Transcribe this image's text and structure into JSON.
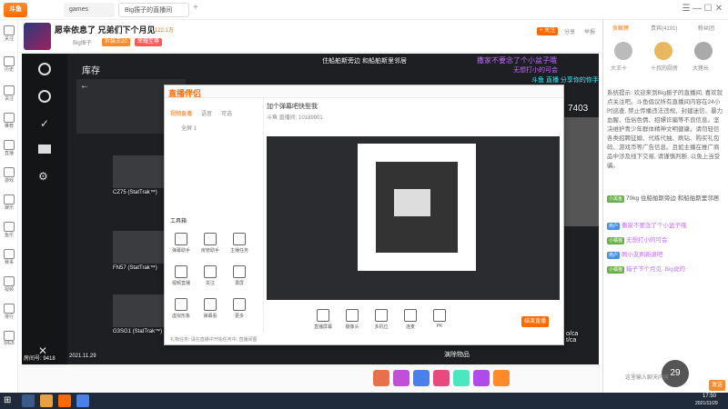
{
  "browser": {
    "logo": "斗鱼",
    "tab1_label": "games",
    "tab2_label": "Big振子的直播间",
    "window_controls": [
      "☰",
      "—",
      "☐",
      "✕"
    ]
  },
  "rail": {
    "items": [
      "关注",
      "历史",
      "关注",
      "推荐",
      "直播",
      "游戏",
      "娱乐",
      "鱼乐",
      "赛事",
      "视频",
      "排行",
      "WEB"
    ]
  },
  "stream": {
    "title": "愿幸依息了 兄弟们下个月见",
    "fans_count": "122.1万",
    "stream_tag": "Big振子",
    "level_badge": "拆装王20",
    "rank_label": "荣耀至尊",
    "follow_label": "+ 关注",
    "share_label": "分享",
    "report_label": "举报",
    "room_id": "房间号: 9418",
    "date": "2021.11.29"
  },
  "video": {
    "inventory_title": "库存",
    "overlay_top": "住船舶斯旁边 和船舶斯里邻居",
    "danmu1": "撒家不要念了个小盆子哦",
    "danmu2": "无想打小的可会",
    "danmu3": "斗鱼 直播 分享你的你手 big",
    "overlay_num": "7403",
    "items": [
      "CZ75 (StatTrak™)",
      "FN57 (StatTrak™)",
      "G3SG1 (StatTrak™)"
    ],
    "bottom_label": "演除物品",
    "right_text": "o/ca\nt/ca"
  },
  "inner_app": {
    "brand": "直播伴侣",
    "tabs": [
      "视频直播",
      "语音",
      "可选"
    ],
    "scene_label": "全屏 1",
    "tools_title": "工具箱",
    "tools": [
      "弹幕助手",
      "房管助手",
      "主播任务",
      "视频直播",
      "关注",
      "录屏",
      "虚拟形象",
      "弹幕看",
      "更多"
    ],
    "stream_title": "加个弹幕吧快型我",
    "stream_meta": "斗鱼 直播间: 10189901",
    "bottom_buttons": [
      "直播屏幕",
      "摄像头",
      "多机位",
      "连麦",
      "PK",
      "弹幕",
      "设置"
    ],
    "start_button": "结束直播",
    "status_text": "礼物任务: 请在直播中开始任务中, 直播间图"
  },
  "chat": {
    "tabs": [
      "贡献榜",
      "贵宾(4191)",
      "粉丝团"
    ],
    "rank_names": [
      "大王十",
      "十叔的厨房",
      "大猪长"
    ],
    "system_notice": "系统提示: 欢迎来到Big振子的直播间, 喜欢就点关注吧。斗鱼倡议所有直播间内容在24小时巡查, 禁止传播违法违规、封建迷信、暴力血腥、低俗色情、招嫖诈骗等不良信息。坚决维护青少年群体精神文明健康。请勿轻信各类招聘征婚、代练代抽、刷钻、购买礼包码、游戏币等广告信息。且如主播在推广商品中涉及线下交易, 请谨慎判断, 以免上当受骗。",
    "messages": [
      {
        "user": "小黑鱼",
        "text": "70kg 住船舶斯旁边 和船舶斯里邻居"
      },
      {
        "user": "用户",
        "text": "撒家不要念了个小盆子哦"
      },
      {
        "user": "小橘猫",
        "text": "无想打小的可会"
      },
      {
        "user": "用户",
        "text": "刷小友刷新滚吧"
      },
      {
        "user": "小橘猫",
        "text": "箱子下个月见, Big说的"
      }
    ],
    "input_placeholder": "这里输入聊天内容",
    "send_label": "发送",
    "gift_counter": "29",
    "zoom": "0"
  },
  "taskbar": {
    "time": "17:50",
    "date": "2021/11/29"
  },
  "colors": {
    "accent": "#ff6a00",
    "danmu_purple": "#c46bff",
    "danmu_cyan": "#3df2ff"
  }
}
